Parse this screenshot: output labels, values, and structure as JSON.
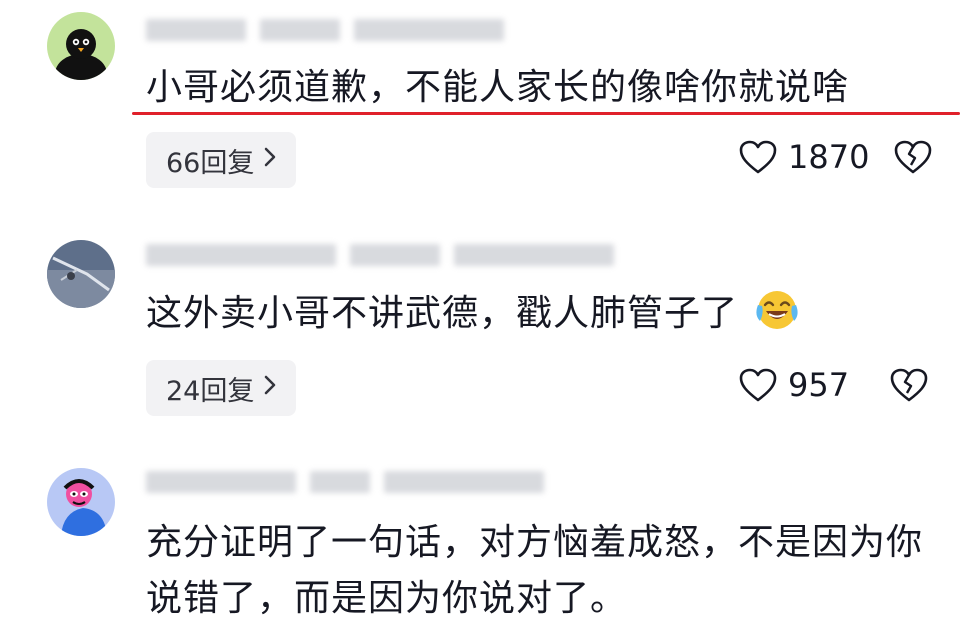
{
  "comments": [
    {
      "text": "小哥必须道歉，不能人家长的像啥你就说啥",
      "reply_label": "66回复",
      "likes": "1870",
      "avatar": "black-bird-icon"
    },
    {
      "text": "这外卖小哥不讲武德，戳人肺管子了",
      "emoji": "crying-laughing-emoji",
      "reply_label": "24回复",
      "likes": "957",
      "avatar": "photo-avatar"
    },
    {
      "text": "充分证明了一句话，对方恼羞成怒，不是因为你说错了，而是因为你说对了。",
      "avatar": "cartoon-avatar"
    }
  ],
  "colors": {
    "highlight_underline": "#e0202a",
    "reply_bg": "#f2f2f4",
    "text": "#161823"
  }
}
